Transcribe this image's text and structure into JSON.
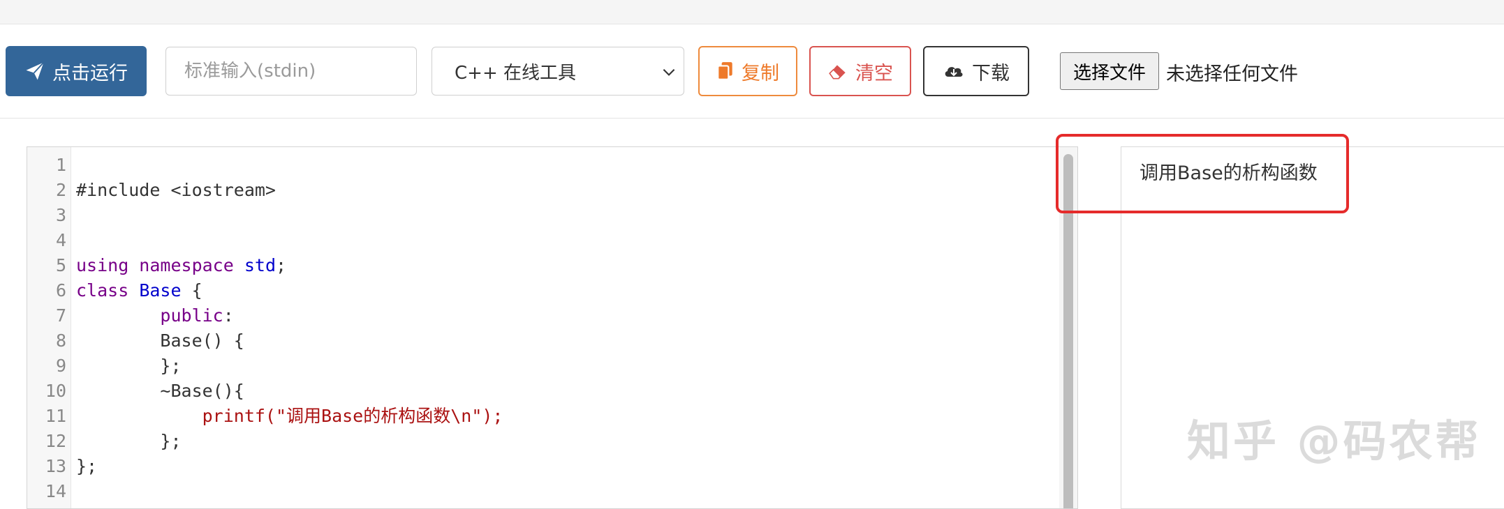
{
  "toolbar": {
    "run_label": "点击运行",
    "stdin_placeholder": "标准输入(stdin)",
    "language_selected": "C++ 在线工具",
    "copy_label": "复制",
    "clear_label": "清空",
    "download_label": "下载",
    "file_button_label": "选择文件",
    "file_status": "未选择任何文件"
  },
  "editor": {
    "line_numbers": [
      "1",
      "2",
      "3",
      "4",
      "5",
      "6",
      "7",
      "8",
      "9",
      "10",
      "11",
      "12",
      "13",
      "14"
    ],
    "lines": [
      "",
      "#include <iostream>",
      "",
      "",
      "using namespace std;",
      "class Base {",
      "        public:",
      "        Base() {",
      "        };",
      "        ~Base(){",
      "            printf(\"调用Base的析构函数\\n\");",
      "        };",
      "};",
      ""
    ]
  },
  "output": {
    "text": "调用Base的析构函数"
  },
  "watermark": "知乎 @码农帮",
  "colors": {
    "run_button": "#336699",
    "copy_button": "#ee7a2a",
    "clear_button": "#d9534f",
    "highlight_box": "#e52b2b"
  }
}
